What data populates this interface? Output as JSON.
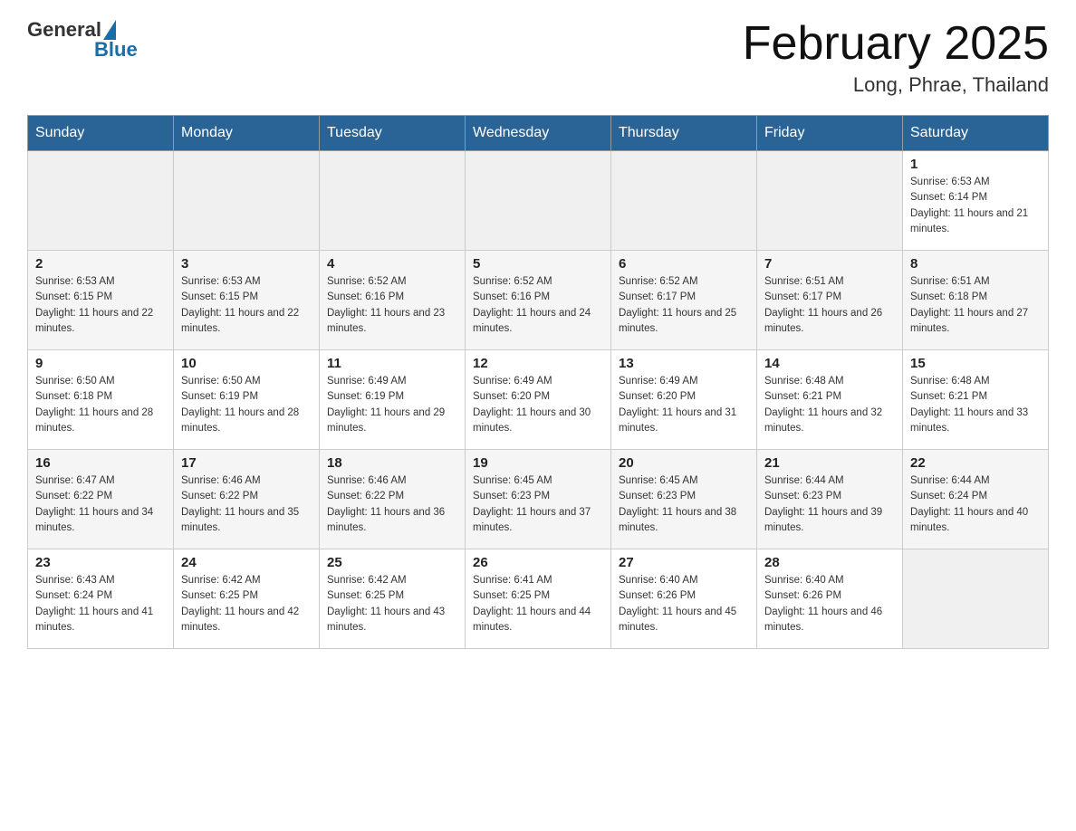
{
  "header": {
    "logo_general": "General",
    "logo_blue": "Blue",
    "month_title": "February 2025",
    "location": "Long, Phrae, Thailand"
  },
  "weekdays": [
    "Sunday",
    "Monday",
    "Tuesday",
    "Wednesday",
    "Thursday",
    "Friday",
    "Saturday"
  ],
  "weeks": [
    [
      {
        "day": "",
        "sunrise": "",
        "sunset": "",
        "daylight": ""
      },
      {
        "day": "",
        "sunrise": "",
        "sunset": "",
        "daylight": ""
      },
      {
        "day": "",
        "sunrise": "",
        "sunset": "",
        "daylight": ""
      },
      {
        "day": "",
        "sunrise": "",
        "sunset": "",
        "daylight": ""
      },
      {
        "day": "",
        "sunrise": "",
        "sunset": "",
        "daylight": ""
      },
      {
        "day": "",
        "sunrise": "",
        "sunset": "",
        "daylight": ""
      },
      {
        "day": "1",
        "sunrise": "Sunrise: 6:53 AM",
        "sunset": "Sunset: 6:14 PM",
        "daylight": "Daylight: 11 hours and 21 minutes."
      }
    ],
    [
      {
        "day": "2",
        "sunrise": "Sunrise: 6:53 AM",
        "sunset": "Sunset: 6:15 PM",
        "daylight": "Daylight: 11 hours and 22 minutes."
      },
      {
        "day": "3",
        "sunrise": "Sunrise: 6:53 AM",
        "sunset": "Sunset: 6:15 PM",
        "daylight": "Daylight: 11 hours and 22 minutes."
      },
      {
        "day": "4",
        "sunrise": "Sunrise: 6:52 AM",
        "sunset": "Sunset: 6:16 PM",
        "daylight": "Daylight: 11 hours and 23 minutes."
      },
      {
        "day": "5",
        "sunrise": "Sunrise: 6:52 AM",
        "sunset": "Sunset: 6:16 PM",
        "daylight": "Daylight: 11 hours and 24 minutes."
      },
      {
        "day": "6",
        "sunrise": "Sunrise: 6:52 AM",
        "sunset": "Sunset: 6:17 PM",
        "daylight": "Daylight: 11 hours and 25 minutes."
      },
      {
        "day": "7",
        "sunrise": "Sunrise: 6:51 AM",
        "sunset": "Sunset: 6:17 PM",
        "daylight": "Daylight: 11 hours and 26 minutes."
      },
      {
        "day": "8",
        "sunrise": "Sunrise: 6:51 AM",
        "sunset": "Sunset: 6:18 PM",
        "daylight": "Daylight: 11 hours and 27 minutes."
      }
    ],
    [
      {
        "day": "9",
        "sunrise": "Sunrise: 6:50 AM",
        "sunset": "Sunset: 6:18 PM",
        "daylight": "Daylight: 11 hours and 28 minutes."
      },
      {
        "day": "10",
        "sunrise": "Sunrise: 6:50 AM",
        "sunset": "Sunset: 6:19 PM",
        "daylight": "Daylight: 11 hours and 28 minutes."
      },
      {
        "day": "11",
        "sunrise": "Sunrise: 6:49 AM",
        "sunset": "Sunset: 6:19 PM",
        "daylight": "Daylight: 11 hours and 29 minutes."
      },
      {
        "day": "12",
        "sunrise": "Sunrise: 6:49 AM",
        "sunset": "Sunset: 6:20 PM",
        "daylight": "Daylight: 11 hours and 30 minutes."
      },
      {
        "day": "13",
        "sunrise": "Sunrise: 6:49 AM",
        "sunset": "Sunset: 6:20 PM",
        "daylight": "Daylight: 11 hours and 31 minutes."
      },
      {
        "day": "14",
        "sunrise": "Sunrise: 6:48 AM",
        "sunset": "Sunset: 6:21 PM",
        "daylight": "Daylight: 11 hours and 32 minutes."
      },
      {
        "day": "15",
        "sunrise": "Sunrise: 6:48 AM",
        "sunset": "Sunset: 6:21 PM",
        "daylight": "Daylight: 11 hours and 33 minutes."
      }
    ],
    [
      {
        "day": "16",
        "sunrise": "Sunrise: 6:47 AM",
        "sunset": "Sunset: 6:22 PM",
        "daylight": "Daylight: 11 hours and 34 minutes."
      },
      {
        "day": "17",
        "sunrise": "Sunrise: 6:46 AM",
        "sunset": "Sunset: 6:22 PM",
        "daylight": "Daylight: 11 hours and 35 minutes."
      },
      {
        "day": "18",
        "sunrise": "Sunrise: 6:46 AM",
        "sunset": "Sunset: 6:22 PM",
        "daylight": "Daylight: 11 hours and 36 minutes."
      },
      {
        "day": "19",
        "sunrise": "Sunrise: 6:45 AM",
        "sunset": "Sunset: 6:23 PM",
        "daylight": "Daylight: 11 hours and 37 minutes."
      },
      {
        "day": "20",
        "sunrise": "Sunrise: 6:45 AM",
        "sunset": "Sunset: 6:23 PM",
        "daylight": "Daylight: 11 hours and 38 minutes."
      },
      {
        "day": "21",
        "sunrise": "Sunrise: 6:44 AM",
        "sunset": "Sunset: 6:23 PM",
        "daylight": "Daylight: 11 hours and 39 minutes."
      },
      {
        "day": "22",
        "sunrise": "Sunrise: 6:44 AM",
        "sunset": "Sunset: 6:24 PM",
        "daylight": "Daylight: 11 hours and 40 minutes."
      }
    ],
    [
      {
        "day": "23",
        "sunrise": "Sunrise: 6:43 AM",
        "sunset": "Sunset: 6:24 PM",
        "daylight": "Daylight: 11 hours and 41 minutes."
      },
      {
        "day": "24",
        "sunrise": "Sunrise: 6:42 AM",
        "sunset": "Sunset: 6:25 PM",
        "daylight": "Daylight: 11 hours and 42 minutes."
      },
      {
        "day": "25",
        "sunrise": "Sunrise: 6:42 AM",
        "sunset": "Sunset: 6:25 PM",
        "daylight": "Daylight: 11 hours and 43 minutes."
      },
      {
        "day": "26",
        "sunrise": "Sunrise: 6:41 AM",
        "sunset": "Sunset: 6:25 PM",
        "daylight": "Daylight: 11 hours and 44 minutes."
      },
      {
        "day": "27",
        "sunrise": "Sunrise: 6:40 AM",
        "sunset": "Sunset: 6:26 PM",
        "daylight": "Daylight: 11 hours and 45 minutes."
      },
      {
        "day": "28",
        "sunrise": "Sunrise: 6:40 AM",
        "sunset": "Sunset: 6:26 PM",
        "daylight": "Daylight: 11 hours and 46 minutes."
      },
      {
        "day": "",
        "sunrise": "",
        "sunset": "",
        "daylight": ""
      }
    ]
  ]
}
